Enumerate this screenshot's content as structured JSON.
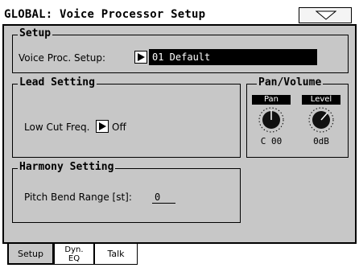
{
  "header": {
    "title": "GLOBAL: Voice Processor Setup",
    "menu_icon": "triangle-down-icon"
  },
  "setup": {
    "title": "Setup",
    "label": "Voice Proc. Setup:",
    "value": "01 Default"
  },
  "lead": {
    "title": "Lead Setting",
    "low_cut_label": "Low Cut Freq.",
    "low_cut_value": "Off"
  },
  "pan_volume": {
    "title": "Pan/Volume",
    "pan": {
      "label": "Pan",
      "value": "C 00"
    },
    "level": {
      "label": "Level",
      "value": "0dB"
    }
  },
  "harmony": {
    "title": "Harmony Setting",
    "pitch_bend_label": "Pitch Bend Range [st]:",
    "pitch_bend_value": "0"
  },
  "tabs": [
    {
      "label": "Setup",
      "active": true
    },
    {
      "label": "Dyn.",
      "label2": "EQ",
      "active": false
    },
    {
      "label": "Talk",
      "active": false
    }
  ]
}
